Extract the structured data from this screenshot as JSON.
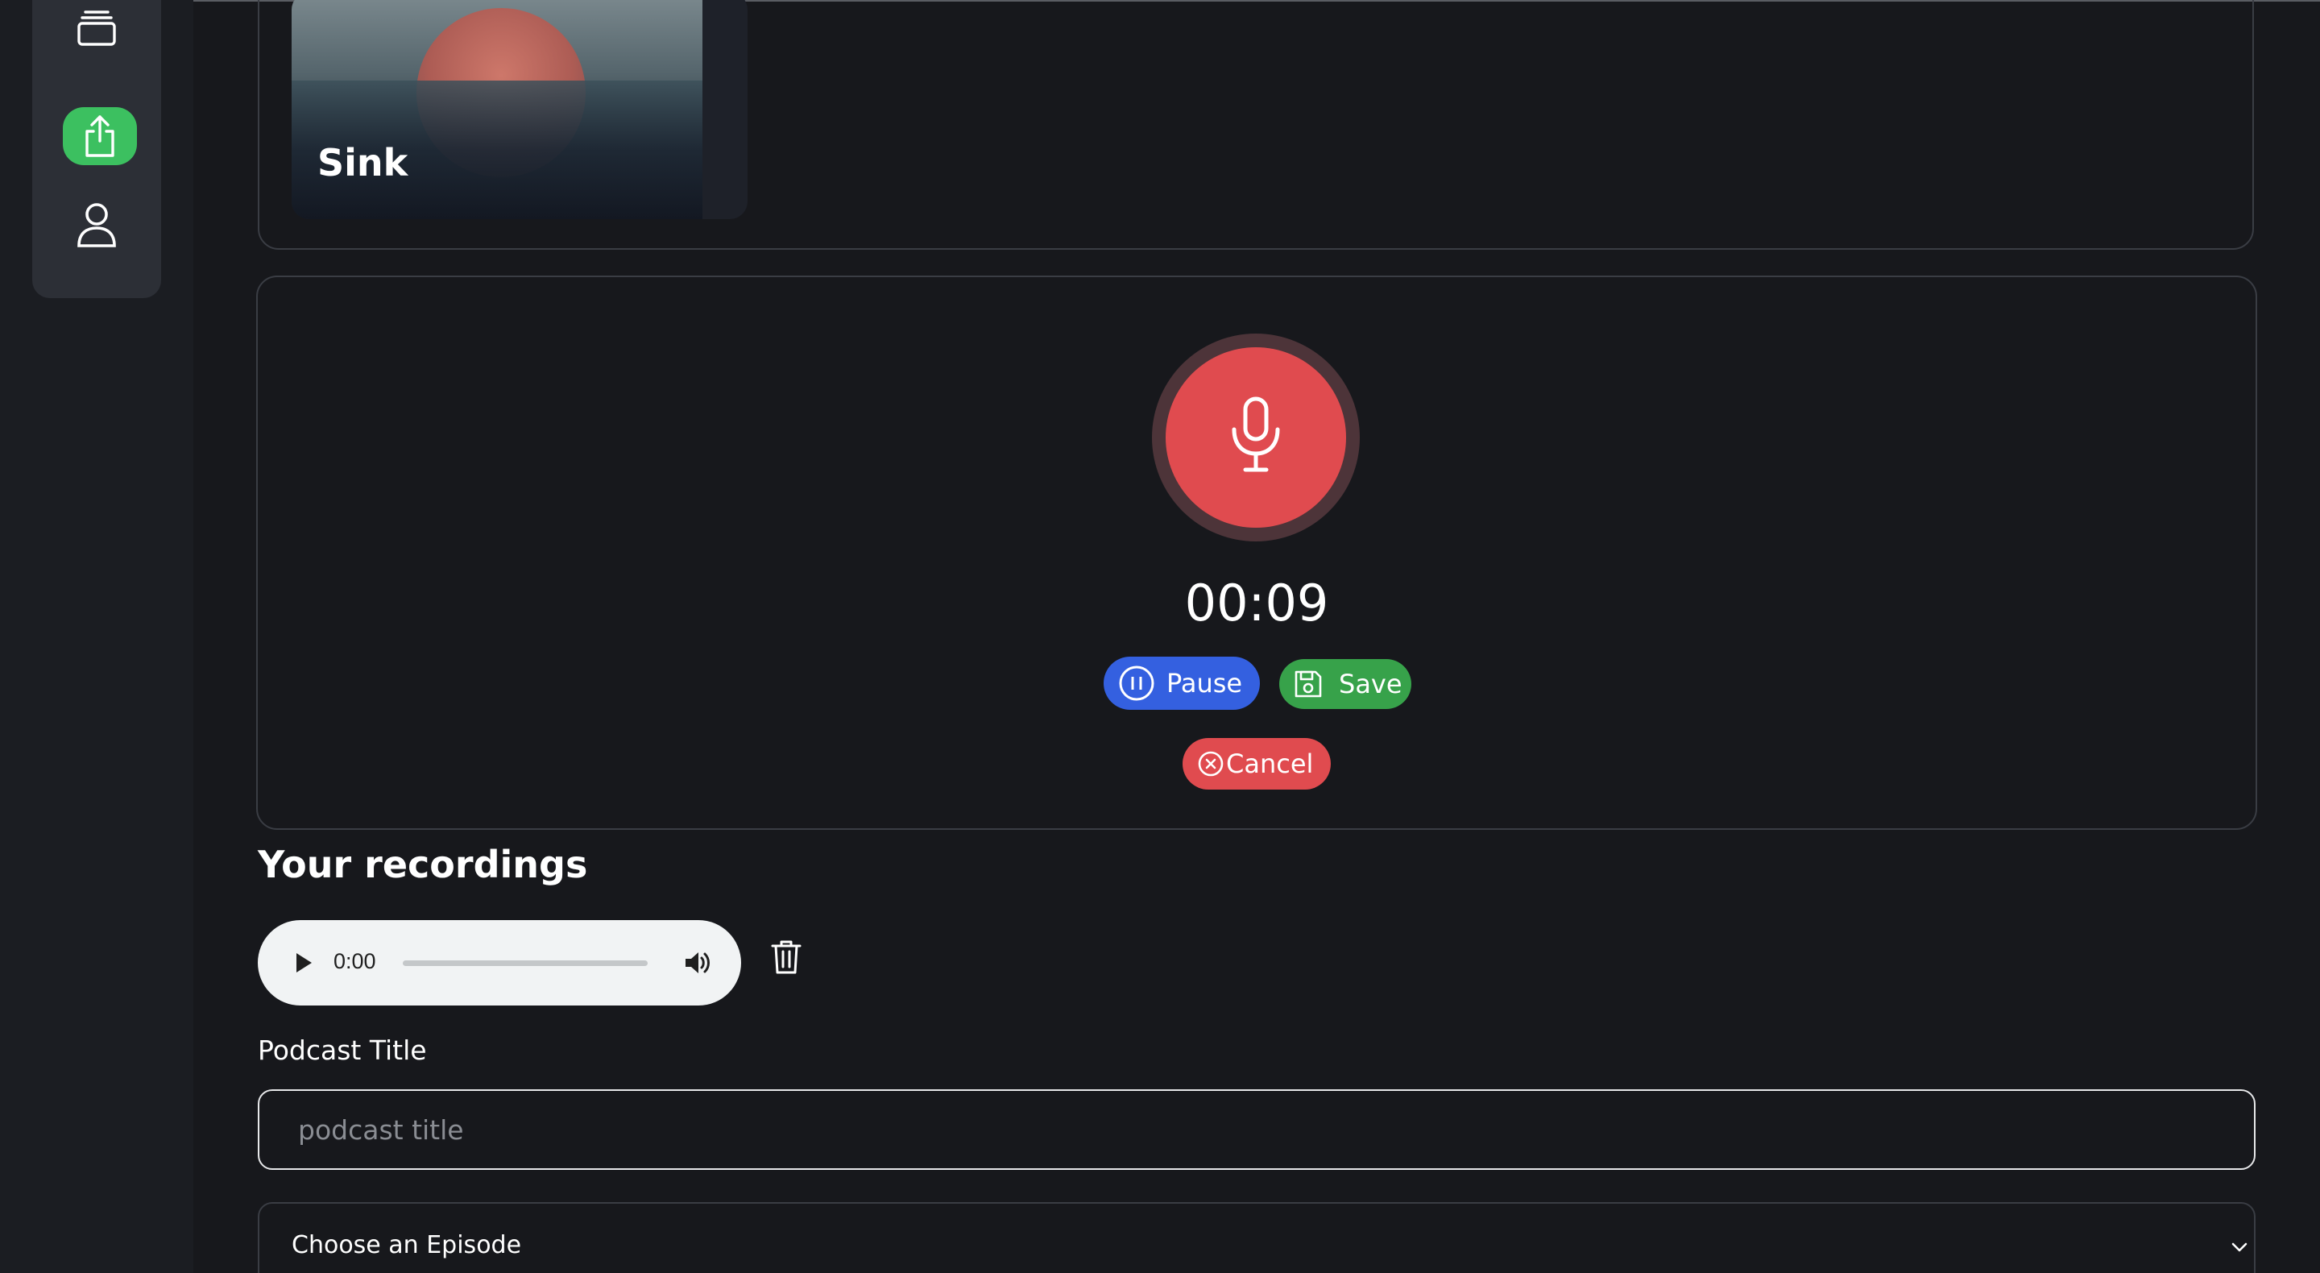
{
  "sidebar": {
    "items": [
      {
        "icon": "library-icon"
      },
      {
        "icon": "upload-icon",
        "active": true
      },
      {
        "icon": "user-icon"
      }
    ]
  },
  "album": {
    "title": "Sink"
  },
  "recorder": {
    "timer": "00:09",
    "pause_label": "Pause",
    "save_label": "Save",
    "cancel_label": "Cancel"
  },
  "recordings": {
    "heading": "Your recordings",
    "player": {
      "current_time": "0:00"
    }
  },
  "form": {
    "title_label": "Podcast Title",
    "title_placeholder": "podcast title",
    "title_value": "",
    "episode_select_value": "Choose an Episode"
  },
  "colors": {
    "background": "#17181c",
    "record_red": "#e04b4f",
    "pause_blue": "#3460e0",
    "save_green": "#37a24a",
    "active_nav_green": "#3cc060"
  }
}
